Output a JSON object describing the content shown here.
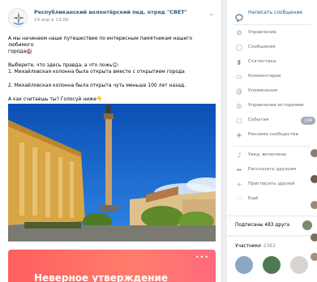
{
  "post": {
    "author": "Республиканский волонтёрский пед. отряд \"СВЕТ\"",
    "date": "19 апр в 13:00",
    "menu_icon": "chevron-down-icon",
    "text_lines": [
      "А мы начинаем наше путешествие по интересным памятникам нашего любимого",
      "города🏰",
      "",
      "Выберите, что здесь правда, а что ложь😊:",
      "1. Михайловская колонна была открыта вместе с открытием города",
      "",
      "2. Михайловская колонна была открыта чуть меньше 100 лет назад.",
      "",
      "А как считаешь ты? Голосуй ниже👇"
    ],
    "banner_text": "Неверное утверждение",
    "banner_dots": "•••"
  },
  "sidebar": {
    "top_action": "Написать сообщение",
    "items": [
      {
        "label": "Управление",
        "icon": "gear-icon"
      },
      {
        "label": "Сообщения",
        "icon": "chat-icon"
      },
      {
        "label": "Статистика",
        "icon": "chart-icon"
      },
      {
        "label": "Комментарии",
        "icon": "comment-icon"
      },
      {
        "label": "Упоминания",
        "icon": "at-icon"
      },
      {
        "label": "Управление историями",
        "icon": "stories-icon"
      },
      {
        "label": "События",
        "icon": "events-icon",
        "count": "104"
      },
      {
        "label": "Реклама сообщества",
        "icon": "ad-icon"
      },
      {
        "label": "Увед. включены",
        "icon": "bell-icon"
      },
      {
        "label": "Рассказать друзьям",
        "icon": "share-icon"
      },
      {
        "label": "Пригласить друзей",
        "icon": "invite-icon"
      },
      {
        "label": "Ещё",
        "icon": "more-icon"
      }
    ]
  },
  "subscribed": {
    "label": "Подписаны 483 друга"
  },
  "members": {
    "label": "Участники",
    "count": "2363"
  },
  "colors": {
    "link": "#2a5885",
    "muted": "#818c99",
    "banner_start": "#ff5f5f",
    "banner_end": "#ff6a7c"
  }
}
